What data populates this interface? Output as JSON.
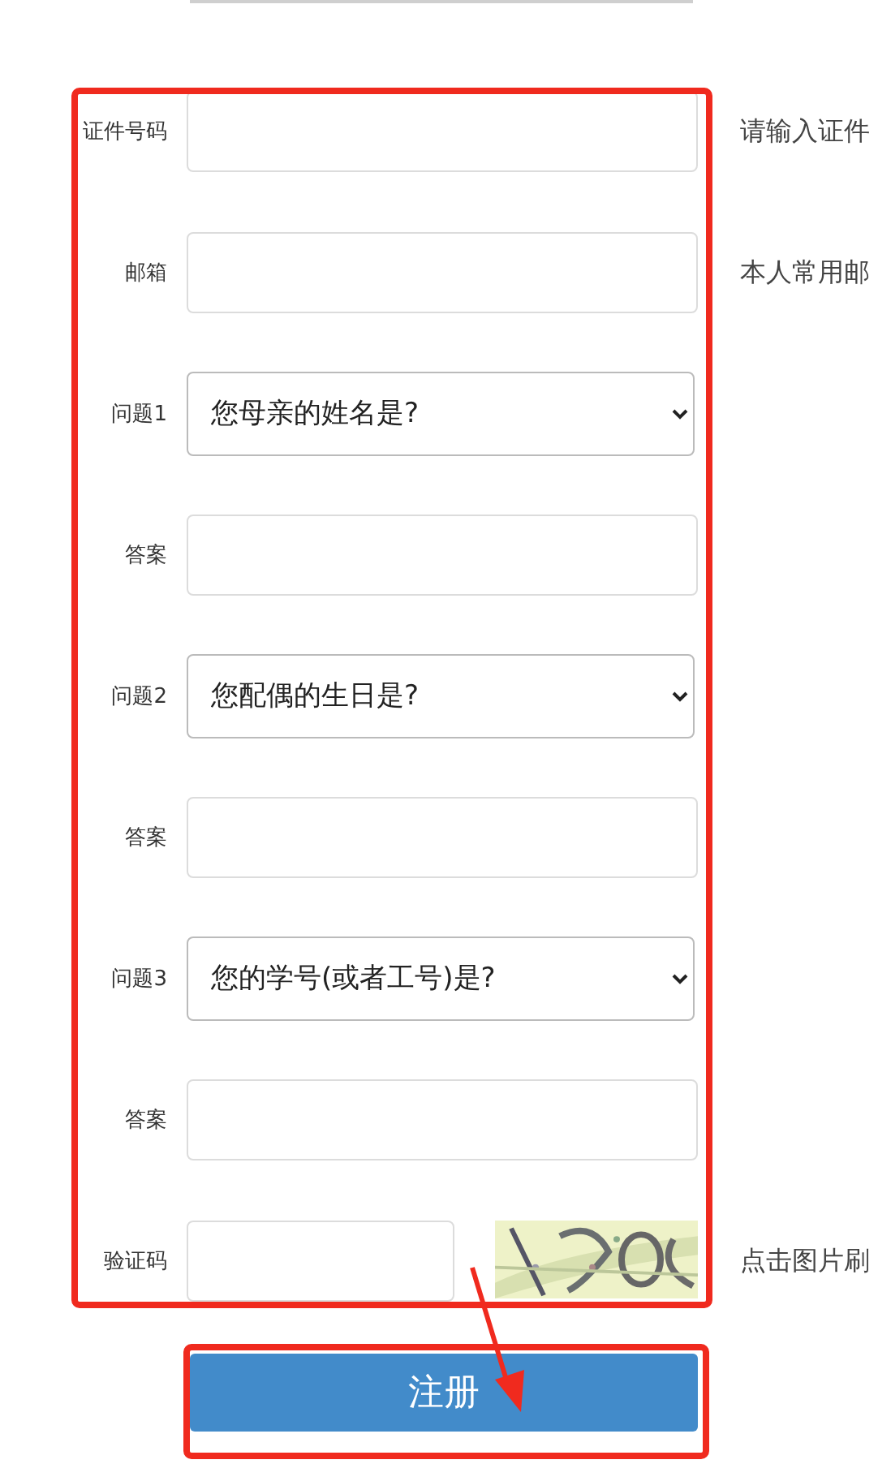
{
  "fields": [
    {
      "label": "证件号码",
      "kind": "input",
      "hint": "请输入证件"
    },
    {
      "label": "邮箱",
      "kind": "input",
      "hint": "本人常用邮"
    },
    {
      "label": "问题1",
      "kind": "select",
      "value": "您母亲的姓名是?"
    },
    {
      "label": "答案",
      "kind": "input"
    },
    {
      "label": "问题2",
      "kind": "select",
      "value": "您配偶的生日是?"
    },
    {
      "label": "答案",
      "kind": "input"
    },
    {
      "label": "问题3",
      "kind": "select",
      "value": "您的学号(或者工号)是?"
    },
    {
      "label": "答案",
      "kind": "input"
    },
    {
      "label": "验证码",
      "kind": "captcha",
      "hint": "点击图片刷"
    }
  ],
  "submit": "注册"
}
